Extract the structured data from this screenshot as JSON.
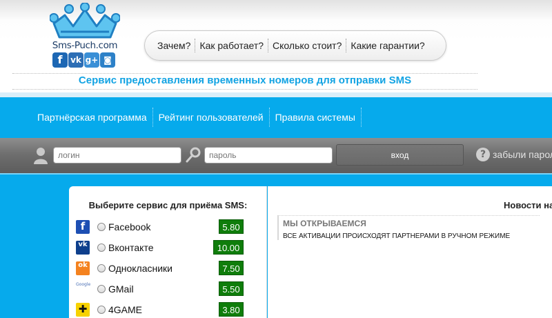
{
  "logo": {
    "text": "Sms-Puch.com",
    "social": [
      {
        "icon": "facebook-icon",
        "glyph": "f"
      },
      {
        "icon": "vk-icon",
        "glyph": "vk"
      },
      {
        "icon": "google-plus-icon",
        "glyph": "g+"
      },
      {
        "icon": "instagram-icon",
        "glyph": "◙"
      }
    ]
  },
  "top_menu": [
    "Зачем?",
    "Как работает?",
    "Сколько стоит?",
    "Какие гарантии?"
  ],
  "tagline": "Сервис предоставления временных номеров для отправки SMS",
  "nav": [
    "Партнёрская программа",
    "Рейтинг пользователей",
    "Правила системы"
  ],
  "login": {
    "login_placeholder": "логин",
    "password_placeholder": "пароль",
    "enter_label": "вход",
    "help_glyph": "?",
    "forgot_label": "забыли пароль?"
  },
  "services": {
    "title": "Выберите сервис для приёма SMS:",
    "items": [
      {
        "name": "Facebook",
        "price": "5.80",
        "icon": "facebook-icon",
        "glyph": "f",
        "color": "#1d4fb3"
      },
      {
        "name": "Вконтакте",
        "price": "10.00",
        "icon": "vk-icon",
        "glyph": "vk",
        "color": "#0e3f8c"
      },
      {
        "name": "Однокласники",
        "price": "7.50",
        "icon": "odnoklassniki-icon",
        "glyph": "ok",
        "color": "#f4821f"
      },
      {
        "name": "GMail",
        "price": "5.50",
        "icon": "google-icon",
        "glyph": "Google",
        "color": "#ffffff"
      },
      {
        "name": "4GAME",
        "price": "3.80",
        "icon": "4game-icon",
        "glyph": "✚",
        "color": "#f7d200"
      }
    ]
  },
  "news": {
    "title": "Новости на",
    "items": [
      {
        "head": "МЫ ОТКРЫВАЕМСЯ",
        "text": "ВСЕ АКТИВАЦИИ ПРОИСХОДЯТ ПАРТНЕРАМИ В РУЧНОМ РЕЖИМЕ"
      }
    ]
  },
  "colors": {
    "accent": "#06aaec",
    "price_bg": "#0f7d0b",
    "tagline": "#12a3e3"
  }
}
